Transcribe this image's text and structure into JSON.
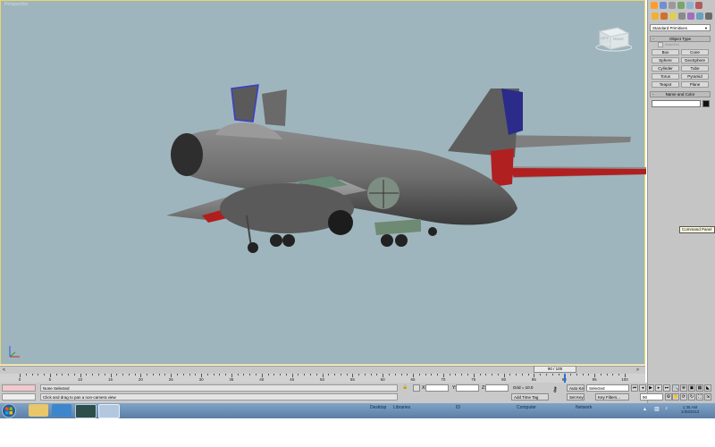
{
  "viewport": {
    "label": "Perspective",
    "viewcube": {
      "left_face": "LEFT",
      "front_face": "FRONT"
    },
    "background": "#9fb5bd"
  },
  "command_panel": {
    "dropdown_value": "Standard Primitives",
    "object_type_header": "Object Type",
    "autogrid_label": "AutoGrid",
    "object_buttons": [
      "Box",
      "Cone",
      "Sphere",
      "GeoSphere",
      "Cylinder",
      "Tube",
      "Torus",
      "Pyramid",
      "Teapot",
      "Plane"
    ],
    "name_color_header": "Name and Color",
    "tooltip": "Command Panel"
  },
  "timeline": {
    "frame_display": "90 / 100",
    "current_frame": 90,
    "total_frames": 100,
    "tick_labels": [
      "0",
      "5",
      "10",
      "15",
      "20",
      "25",
      "30",
      "35",
      "40",
      "45",
      "50",
      "55",
      "60",
      "65",
      "70",
      "75",
      "80",
      "85",
      "90",
      "95",
      "100"
    ]
  },
  "status_bar": {
    "selection_text": "None Selected",
    "prompt_text": "Click and drag to pan a non-camera view",
    "x_label": "X:",
    "y_label": "Y:",
    "z_label": "Z:",
    "grid_text": "Grid = 10.0",
    "add_time_tag": "Add Time Tag",
    "auto_key": "Auto Key",
    "set_key": "Set Key",
    "selected_dropdown": "Selected",
    "key_filters": "Key Filters...",
    "frame_field": "90"
  },
  "taskbar": {
    "links": [
      "Desktop",
      "Libraries",
      "ID",
      "Computer",
      "Network"
    ],
    "clock_time": "1:35 AM",
    "clock_date": "1/30/2013"
  }
}
